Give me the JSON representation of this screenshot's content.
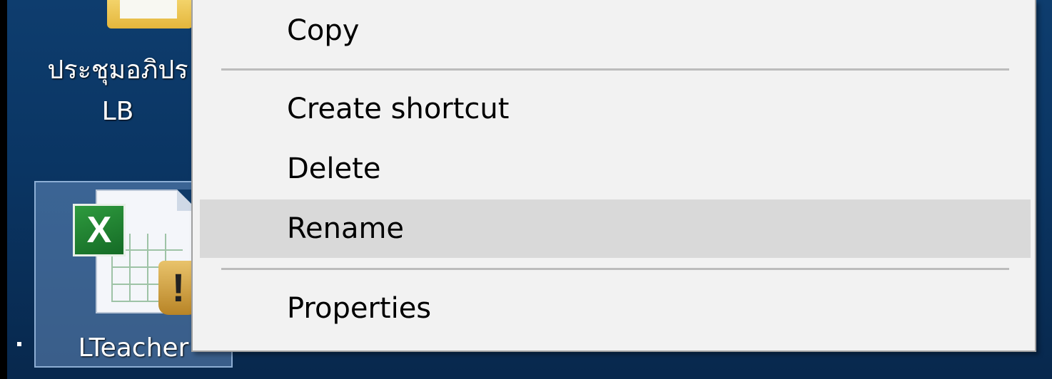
{
  "desktop": {
    "icons": [
      {
        "label_line1": "ประชุมอภิปร",
        "label_line2": "LB"
      },
      {
        "label": "LTeacher"
      }
    ]
  },
  "context_menu": {
    "items": [
      {
        "label": "Copy"
      },
      {
        "label": "Create shortcut"
      },
      {
        "label": "Delete"
      },
      {
        "label": "Rename",
        "highlighted": true
      },
      {
        "label": "Properties"
      }
    ]
  },
  "icons": {
    "excel_badge": "X",
    "warning_mark": "!"
  }
}
